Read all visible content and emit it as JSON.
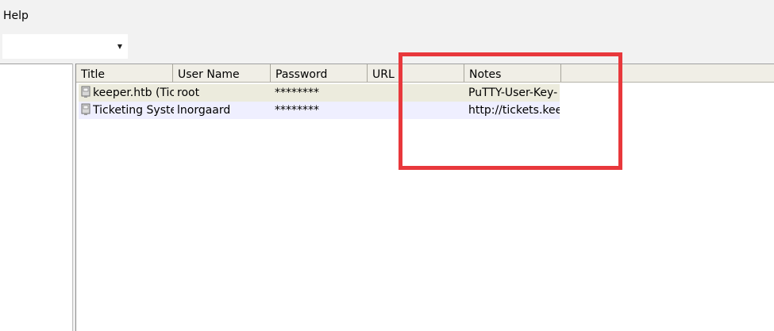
{
  "menubar": {
    "help_label": "Help"
  },
  "group_combo": {
    "value": "",
    "arrow_icon": "dropdown-arrow-icon"
  },
  "entries_table": {
    "columns": [
      "Title",
      "User Name",
      "Password",
      "URL",
      "Notes"
    ],
    "rows": [
      {
        "icon": "key-entry-icon",
        "title": "keeper.htb (Tick",
        "username": "root",
        "password": "********",
        "url": "",
        "notes": "PuTTY-User-Key-"
      },
      {
        "icon": "key-entry-icon",
        "title": "Ticketing Syster",
        "username": "lnorgaard",
        "password": "********",
        "url": "",
        "notes": "http://tickets.keep"
      }
    ]
  },
  "annotation": {
    "highlight_color": "#e8383c"
  }
}
